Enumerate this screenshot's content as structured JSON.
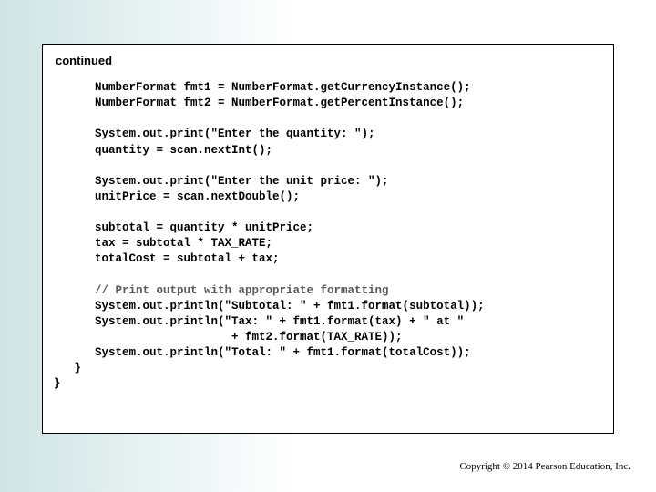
{
  "header": {
    "continued": "continued"
  },
  "code": {
    "l1": "      NumberFormat fmt1 = NumberFormat.getCurrencyInstance();",
    "l2": "      NumberFormat fmt2 = NumberFormat.getPercentInstance();",
    "l3": "",
    "l4": "      System.out.print(\"Enter the quantity: \");",
    "l5": "      quantity = scan.nextInt();",
    "l6": "",
    "l7": "      System.out.print(\"Enter the unit price: \");",
    "l8": "      unitPrice = scan.nextDouble();",
    "l9": "",
    "l10": "      subtotal = quantity * unitPrice;",
    "l11": "      tax = subtotal * TAX_RATE;",
    "l12": "      totalCost = subtotal + tax;",
    "l13": "",
    "l14_comment": "      // Print output with appropriate formatting",
    "l15": "      System.out.println(\"Subtotal: \" + fmt1.format(subtotal));",
    "l16": "      System.out.println(\"Tax: \" + fmt1.format(tax) + \" at \"",
    "l17": "                          + fmt2.format(TAX_RATE));",
    "l18": "      System.out.println(\"Total: \" + fmt1.format(totalCost));",
    "l19": "   }",
    "l20": "}"
  },
  "footer": {
    "copyright": "Copyright © 2014 Pearson Education, Inc."
  }
}
